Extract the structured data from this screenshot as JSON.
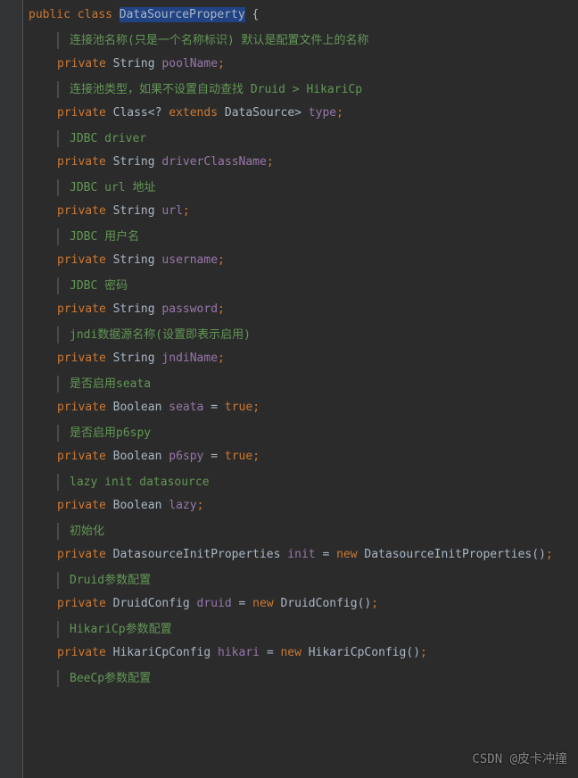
{
  "decl": {
    "kw1": "public",
    "kw2": "class",
    "className": "DataSourceProperty",
    "brace": "{"
  },
  "semi": ";",
  "eq": "=",
  "entries": [
    {
      "doc": "连接池名称(只是一个名称标识) 默认是配置文件上的名称",
      "mod": "private",
      "type": "String",
      "name": "poolName"
    },
    {
      "doc": "连接池类型，如果不设置自动查找 Druid > HikariCp",
      "mod": "private",
      "typePre": "Class<?",
      "kwExt": "extends",
      "typePost": "DataSource>",
      "name": "type"
    },
    {
      "doc": "JDBC driver",
      "mod": "private",
      "type": "String",
      "name": "driverClassName"
    },
    {
      "doc": "JDBC url 地址",
      "mod": "private",
      "type": "String",
      "name": "url"
    },
    {
      "doc": "JDBC 用户名",
      "mod": "private",
      "type": "String",
      "name": "username"
    },
    {
      "doc": "JDBC 密码",
      "mod": "private",
      "type": "String",
      "name": "password"
    },
    {
      "doc": "jndi数据源名称(设置即表示启用)",
      "mod": "private",
      "type": "String",
      "name": "jndiName"
    },
    {
      "doc": "是否启用seata",
      "mod": "private",
      "type": "Boolean",
      "name": "seata",
      "value": "true"
    },
    {
      "doc": "是否启用p6spy",
      "mod": "private",
      "type": "Boolean",
      "name": "p6spy",
      "value": "true"
    },
    {
      "doc": "lazy init datasource",
      "mod": "private",
      "type": "Boolean",
      "name": "lazy"
    },
    {
      "doc": "初始化",
      "mod": "private",
      "type": "DatasourceInitProperties",
      "name": "init",
      "newKw": "new",
      "ctor": "DatasourceInitProperties()"
    },
    {
      "doc": "Druid参数配置",
      "mod": "private",
      "type": "DruidConfig",
      "name": "druid",
      "newKw": "new",
      "ctor": "DruidConfig()"
    },
    {
      "doc": "HikariCp参数配置",
      "mod": "private",
      "type": "HikariCpConfig",
      "name": "hikari",
      "newKw": "new",
      "ctor": "HikariCpConfig()"
    },
    {
      "doc": "BeeCp参数配置"
    }
  ],
  "watermark": "CSDN @皮卡冲撞"
}
